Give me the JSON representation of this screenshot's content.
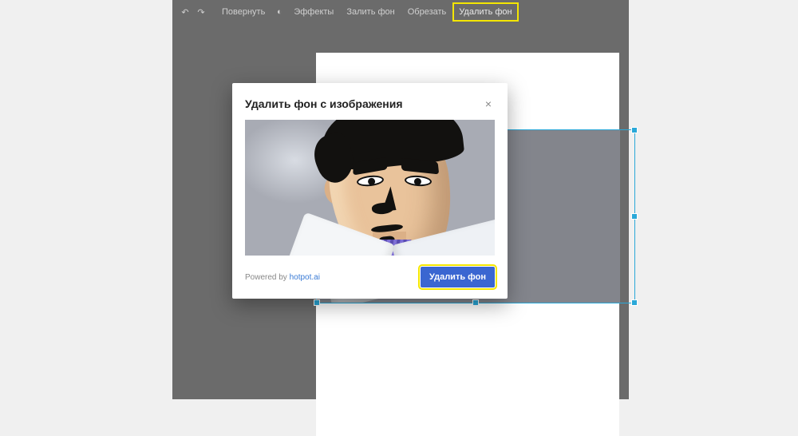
{
  "toolbar": {
    "items": [
      {
        "label": "Повернуть"
      },
      {
        "label": "Эффекты"
      },
      {
        "label": "Залить фон"
      },
      {
        "label": "Обрезать"
      },
      {
        "label": "Удалить фон"
      }
    ],
    "highlight_index": 4
  },
  "modal": {
    "title": "Удалить фон с изображения",
    "close_glyph": "×",
    "powered_prefix": "Powered by ",
    "powered_link_text": "hotpot.ai",
    "primary_button_label": "Удалить фон"
  },
  "colors": {
    "highlight": "#f4e600",
    "primary": "#3a66d1",
    "selection": "#2aa8d8"
  },
  "icons": {
    "undo": "↶",
    "redo": "↷",
    "effects": "◐"
  }
}
